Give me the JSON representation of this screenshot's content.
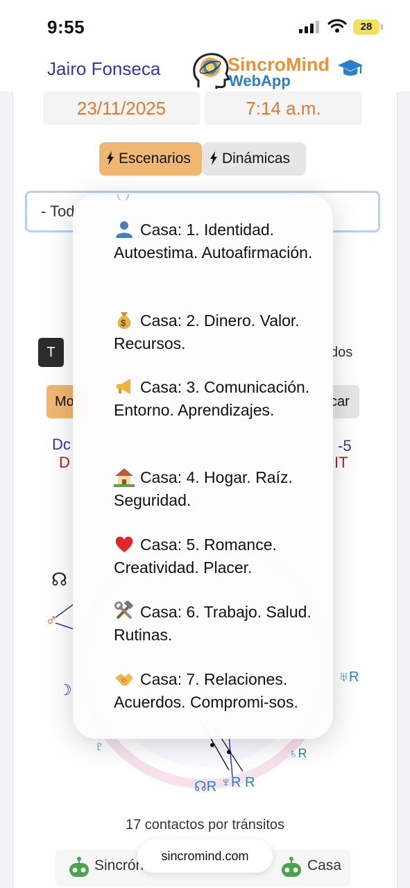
{
  "status_bar": {
    "time": "9:55",
    "battery": "28"
  },
  "header": {
    "user_name": "Jairo Fonseca",
    "brand_line1": "SincroMind",
    "brand_line2": "WebApp"
  },
  "datetime": {
    "date": "23/11/2025",
    "time": "7:14 a.m."
  },
  "tabs": [
    {
      "label": "Escenarios",
      "active": true
    },
    {
      "label": "Dinámicas",
      "active": false
    }
  ],
  "select": {
    "value": "- Tod"
  },
  "peek": {
    "t_button": "T",
    "dos": "dos",
    "mo": "Mo",
    "car": "car",
    "dc": "Dc",
    "d": "D",
    "minus5": "-5",
    "it": "IT"
  },
  "dropdown": {
    "cutoff_text": "(   )",
    "options": [
      {
        "icon": "person-silhouette-icon",
        "label": "Casa: 1. Identidad. Autoestima. Autoafirmación."
      },
      {
        "icon": "money-bag-icon",
        "label": "Casa: 2. Dinero. Valor. Recursos."
      },
      {
        "icon": "megaphone-icon",
        "label": "Casa: 3. Comunicación. Entorno. Aprendizajes."
      },
      {
        "icon": "house-garden-icon",
        "label": "Casa: 4. Hogar. Raíz. Seguridad."
      },
      {
        "icon": "red-heart-icon",
        "label": "Casa: 5. Romance. Creatividad. Placer."
      },
      {
        "icon": "hammer-wrench-icon",
        "label": "Casa: 6. Trabajo. Salud. Rutinas."
      },
      {
        "icon": "handshake-icon",
        "label": "Casa: 7. Relaciones. Acuerdos. Compromi-sos."
      }
    ]
  },
  "footer": {
    "contacts": "17 contactos por tránsitos",
    "url": "sincromind.com",
    "left_label": "Sincrón",
    "right_label": "Casa"
  }
}
